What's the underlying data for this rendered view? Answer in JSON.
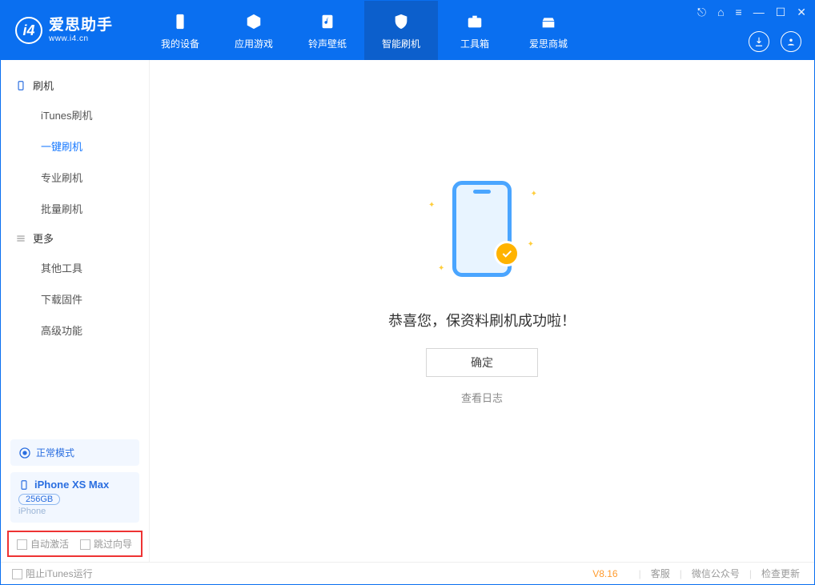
{
  "brand": {
    "cn": "爱思助手",
    "en": "www.i4.cn"
  },
  "tabs": [
    {
      "label": "我的设备"
    },
    {
      "label": "应用游戏"
    },
    {
      "label": "铃声壁纸"
    },
    {
      "label": "智能刷机"
    },
    {
      "label": "工具箱"
    },
    {
      "label": "爱思商城"
    }
  ],
  "sidebar": {
    "group1": "刷机",
    "items1": [
      "iTunes刷机",
      "一键刷机",
      "专业刷机",
      "批量刷机"
    ],
    "group2": "更多",
    "items2": [
      "其他工具",
      "下载固件",
      "高级功能"
    ]
  },
  "mode": "正常模式",
  "device": {
    "name": "iPhone XS Max",
    "capacity": "256GB",
    "type": "iPhone"
  },
  "bottom_checks": {
    "auto_activate": "自动激活",
    "skip_guide": "跳过向导"
  },
  "main": {
    "success": "恭喜您，保资料刷机成功啦！",
    "ok": "确定",
    "view_log": "查看日志"
  },
  "footer": {
    "block_itunes": "阻止iTunes运行",
    "version": "V8.16",
    "links": [
      "客服",
      "微信公众号",
      "检查更新"
    ]
  }
}
